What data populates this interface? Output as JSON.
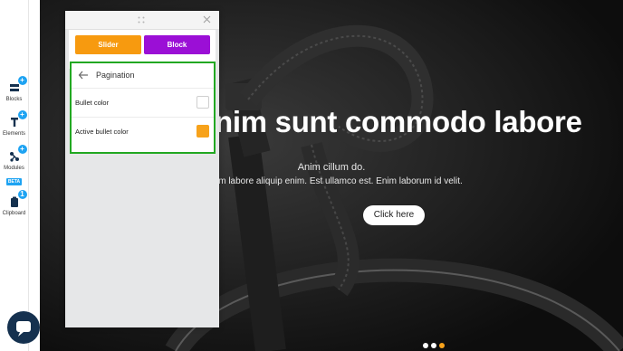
{
  "sidebar": {
    "items": [
      {
        "label": "Blocks",
        "badge": "+",
        "icon": "blocks-icon"
      },
      {
        "label": "Elements",
        "badge": "+",
        "icon": "elements-icon"
      },
      {
        "label": "Modules",
        "badge": "+",
        "tag": "BETA",
        "icon": "modules-icon"
      },
      {
        "label": "Clipboard",
        "badge": "1",
        "icon": "clipboard-icon"
      }
    ]
  },
  "panel": {
    "tabs": [
      {
        "label": "Slider",
        "color": "#f79a0f"
      },
      {
        "label": "Block",
        "color": "#9b0fd6"
      }
    ],
    "section": {
      "title": "Pagination",
      "rows": [
        {
          "label": "Bullet color",
          "color": "#ffffff"
        },
        {
          "label": "Active bullet color",
          "color": "#f7a21b"
        }
      ]
    }
  },
  "hero": {
    "heading": "nim sunt commodo labore",
    "line1": "Anim cillum do.",
    "line2": "Lorem labore aliquip enim. Est ullamco est. Enim laborum id velit.",
    "cta": "Click here",
    "dots": {
      "count": 3,
      "active": 3,
      "active_color": "#f7a21b",
      "color": "#ffffff"
    }
  },
  "colors": {
    "accent_blue": "#1ea3f2",
    "highlight_green": "#22a822",
    "chat_button": "#15314f"
  }
}
